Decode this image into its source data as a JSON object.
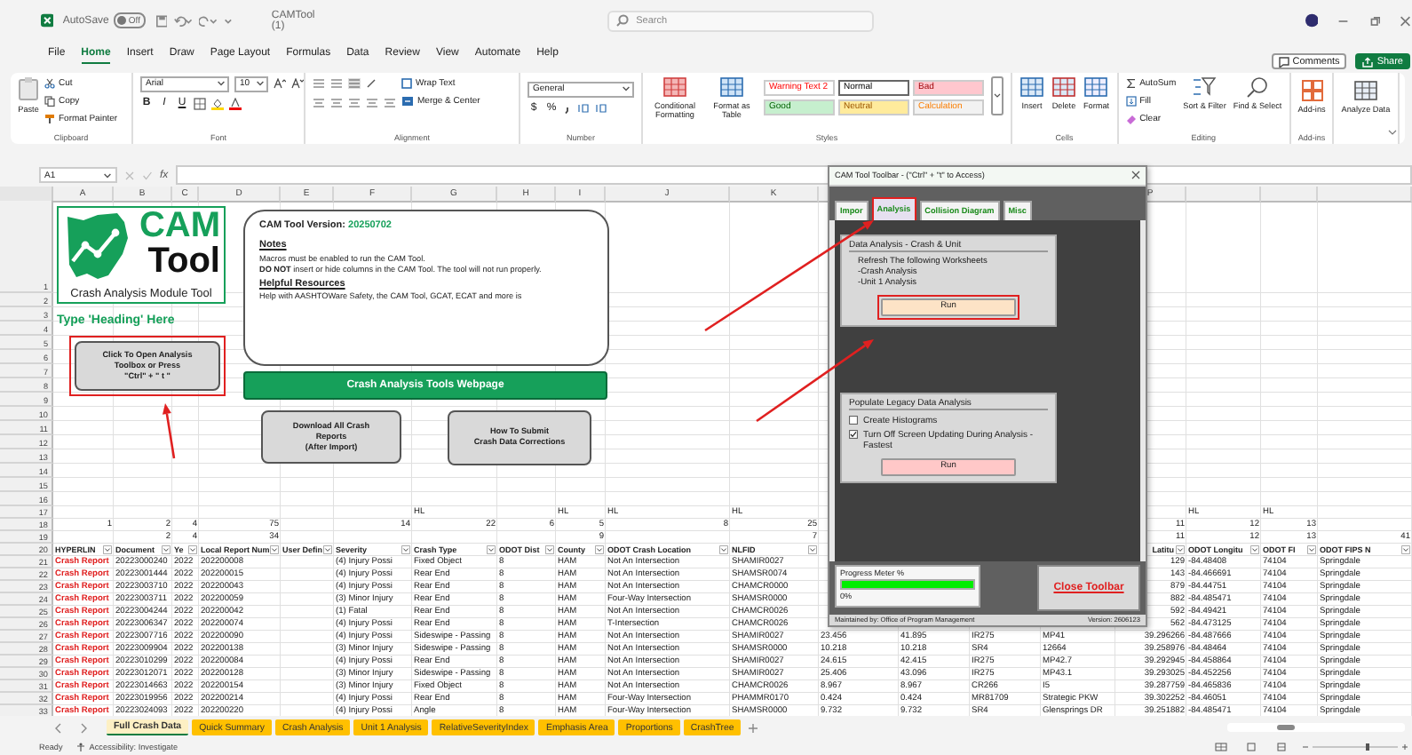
{
  "title_bar": {
    "autosave_label": "AutoSave",
    "autosave_toggle": {
      "label": "Off",
      "on": false
    },
    "file_name": "CAMTool (1)",
    "search_placeholder": "Search"
  },
  "menu": [
    {
      "label": "File",
      "selected": false
    },
    {
      "label": "Home",
      "selected": true
    },
    {
      "label": "Insert",
      "selected": false
    },
    {
      "label": "Draw",
      "selected": false
    },
    {
      "label": "Page Layout",
      "selected": false
    },
    {
      "label": "Formulas",
      "selected": false
    },
    {
      "label": "Data",
      "selected": false
    },
    {
      "label": "Review",
      "selected": false
    },
    {
      "label": "View",
      "selected": false
    },
    {
      "label": "Automate",
      "selected": false
    },
    {
      "label": "Help",
      "selected": false
    }
  ],
  "comments_button": "Comments",
  "share_button": "Share",
  "ribbon": {
    "clipboard": {
      "label": "Clipboard",
      "paste": "Paste",
      "cut": "Cut",
      "copy": "Copy",
      "format_painter": "Format Painter"
    },
    "font": {
      "label": "Font",
      "font_name": "Arial",
      "font_size": "10",
      "bold": "B",
      "italic": "I",
      "underline": "U"
    },
    "alignment": {
      "label": "Alignment",
      "wrap_text": "Wrap Text",
      "merge_center": "Merge & Center"
    },
    "number": {
      "label": "Number",
      "format": "General",
      "currency": "$",
      "percent": "%"
    },
    "styles": {
      "label": "Styles",
      "conditional_formatting": "Conditional Formatting",
      "format_as_table": "Format as Table",
      "cell_styles": [
        {
          "label": "Warning Text 2",
          "kind": "warning",
          "selected": false
        },
        {
          "label": "Normal",
          "kind": "normal",
          "selected": true
        },
        {
          "label": "Bad",
          "kind": "bad",
          "selected": false
        },
        {
          "label": "Good",
          "kind": "good",
          "selected": false
        },
        {
          "label": "Neutral",
          "kind": "neutral",
          "selected": false
        },
        {
          "label": "Calculation",
          "kind": "calculation",
          "selected": false
        }
      ]
    },
    "cells": {
      "label": "Cells",
      "insert": "Insert",
      "delete": "Delete",
      "format": "Format"
    },
    "editing": {
      "label": "Editing",
      "autosum": "AutoSum",
      "fill": "Fill",
      "clear": "Clear",
      "sort_filter": "Sort & Filter",
      "find_select": "Find & Select"
    },
    "add_ins": {
      "label": "Add-ins",
      "button": "Add-ins"
    },
    "analyze": {
      "button": "Analyze Data"
    }
  },
  "formula_bar": {
    "name_box": "A1",
    "fx": "fx"
  },
  "sheet": {
    "column_letters": [
      "A",
      "B",
      "C",
      "D",
      "E",
      "F",
      "G",
      "H",
      "I",
      "J",
      "K"
    ],
    "column_letters_right": [
      "P"
    ],
    "rows": [
      {
        "number": "1"
      },
      {
        "number": "2"
      },
      {
        "number": "3"
      },
      {
        "number": "4"
      },
      {
        "number": "5"
      },
      {
        "number": "6"
      },
      {
        "number": "7"
      },
      {
        "number": "8"
      },
      {
        "number": "9"
      },
      {
        "number": "10"
      },
      {
        "number": "11"
      },
      {
        "number": "12"
      },
      {
        "number": "13"
      },
      {
        "number": "14"
      },
      {
        "number": "15"
      },
      {
        "number": "16"
      },
      {
        "number": "17",
        "kind": "marker",
        "cells": [
          null,
          null,
          null,
          null,
          null,
          null,
          "HL",
          null,
          "HL",
          "HL",
          "HL",
          null,
          null,
          null,
          null,
          null,
          "HL",
          "HL"
        ]
      },
      {
        "number": "18",
        "kind": "index",
        "cells": [
          "1",
          "2",
          "4",
          "75",
          null,
          "14",
          "22",
          "6",
          "5",
          "8",
          "25",
          null,
          null,
          null,
          null,
          "11",
          "12",
          "13"
        ]
      },
      {
        "number": "19",
        "kind": "index",
        "cells": [
          null,
          "2",
          "4",
          "34",
          null,
          null,
          null,
          null,
          "9",
          null,
          "7",
          null,
          null,
          null,
          null,
          "11",
          "12",
          "13",
          "41"
        ]
      },
      {
        "number": "20",
        "kind": "header",
        "cells": [
          "HYPERLIN",
          "Document",
          "Ye",
          "Local Report Num",
          "User Defin",
          "Severity",
          "Crash Type",
          "ODOT Dist",
          "County",
          "ODOT Crash Location",
          "NLFID",
          null,
          null,
          null,
          null,
          "Latitu",
          "ODOT Longitu",
          "ODOT FI",
          "ODOT FIPS N"
        ]
      },
      {
        "number": "21",
        "kind": "data",
        "cells": [
          "Crash Report",
          "20223000240",
          "2022",
          "202200008",
          null,
          "(4) Injury Possi",
          "Fixed Object",
          "8",
          "HAM",
          "Not An Intersection",
          "SHAMIR0027",
          null,
          null,
          null,
          null,
          "129",
          "-84.48408",
          "74104",
          "Springdale"
        ]
      },
      {
        "number": "22",
        "kind": "data",
        "cells": [
          "Crash Report",
          "20223001444",
          "2022",
          "202200015",
          null,
          "(4) Injury Possi",
          "Rear End",
          "8",
          "HAM",
          "Not An Intersection",
          "SHAMSR0074",
          null,
          null,
          null,
          null,
          "143",
          "-84.466691",
          "74104",
          "Springdale"
        ]
      },
      {
        "number": "23",
        "kind": "data",
        "cells": [
          "Crash Report",
          "20223003710",
          "2022",
          "202200043",
          null,
          "(4) Injury Possi",
          "Rear End",
          "8",
          "HAM",
          "Not An Intersection",
          "CHAMCR0000",
          null,
          null,
          null,
          null,
          "879",
          "-84.44751",
          "74104",
          "Springdale"
        ]
      },
      {
        "number": "24",
        "kind": "data",
        "cells": [
          "Crash Report",
          "20223003711",
          "2022",
          "202200059",
          null,
          "(3) Minor Injury",
          "Rear End",
          "8",
          "HAM",
          "Four-Way Intersection",
          "SHAMSR0000",
          null,
          null,
          null,
          null,
          "882",
          "-84.485471",
          "74104",
          "Springdale"
        ]
      },
      {
        "number": "25",
        "kind": "data",
        "cells": [
          "Crash Report",
          "20223004244",
          "2022",
          "202200042",
          null,
          "(1) Fatal",
          "Rear End",
          "8",
          "HAM",
          "Not An Intersection",
          "CHAMCR0026",
          null,
          null,
          null,
          null,
          "592",
          "-84.49421",
          "74104",
          "Springdale"
        ]
      },
      {
        "number": "26",
        "kind": "data",
        "cells": [
          "Crash Report",
          "20223006347",
          "2022",
          "202200074",
          null,
          "(4) Injury Possi",
          "Rear End",
          "8",
          "HAM",
          "T-Intersection",
          "CHAMCR0026",
          null,
          null,
          null,
          null,
          "562",
          "-84.473125",
          "74104",
          "Springdale"
        ]
      },
      {
        "number": "27",
        "kind": "data",
        "cells": [
          "Crash Report",
          "20223007716",
          "2022",
          "202200090",
          null,
          "(4) Injury Possi",
          "Sideswipe - Passing",
          "8",
          "HAM",
          "Not An Intersection",
          "SHAMIR0027",
          "23.456",
          "41.895",
          "IR275",
          "MP41",
          "39.296266",
          "-84.487666",
          "74104",
          "Springdale"
        ]
      },
      {
        "number": "28",
        "kind": "data",
        "cells": [
          "Crash Report",
          "20223009904",
          "2022",
          "202200138",
          null,
          "(3) Minor Injury",
          "Sideswipe - Passing",
          "8",
          "HAM",
          "Not An Intersection",
          "SHAMSR0000",
          "10.218",
          "10.218",
          "SR4",
          "12664",
          "39.258976",
          "-84.48464",
          "74104",
          "Springdale"
        ]
      },
      {
        "number": "29",
        "kind": "data",
        "cells": [
          "Crash Report",
          "20223010299",
          "2022",
          "202200084",
          null,
          "(4) Injury Possi",
          "Rear End",
          "8",
          "HAM",
          "Not An Intersection",
          "SHAMIR0027",
          "24.615",
          "42.415",
          "IR275",
          "MP42.7",
          "39.292945",
          "-84.458864",
          "74104",
          "Springdale"
        ]
      },
      {
        "number": "30",
        "kind": "data",
        "cells": [
          "Crash Report",
          "20223012071",
          "2022",
          "202200128",
          null,
          "(3) Minor Injury",
          "Sideswipe - Passing",
          "8",
          "HAM",
          "Not An Intersection",
          "SHAMIR0027",
          "25.406",
          "43.096",
          "IR275",
          "MP43.1",
          "39.293025",
          "-84.452256",
          "74104",
          "Springdale"
        ]
      },
      {
        "number": "31",
        "kind": "data",
        "cells": [
          "Crash Report",
          "20223014663",
          "2022",
          "202200154",
          null,
          "(3) Minor Injury",
          "Fixed Object",
          "8",
          "HAM",
          "Not An Intersection",
          "CHAMCR0026",
          "8.967",
          "8.967",
          "CR266",
          "I5",
          "39.287759",
          "-84.465836",
          "74104",
          "Springdale"
        ]
      },
      {
        "number": "32",
        "kind": "data",
        "cells": [
          "Crash Report",
          "20223019956",
          "2022",
          "202200214",
          null,
          "(4) Injury Possi",
          "Rear End",
          "8",
          "HAM",
          "Four-Way Intersection",
          "PHAMMR0170",
          "0.424",
          "0.424",
          "MR81709",
          "Strategic PKW",
          "39.302252",
          "-84.46051",
          "74104",
          "Springdale"
        ]
      },
      {
        "number": "33",
        "kind": "data",
        "cells": [
          "Crash Report",
          "20223024093",
          "2022",
          "202200220",
          null,
          "(4) Injury Possi",
          "Angle",
          "8",
          "HAM",
          "Four-Way Intersection",
          "SHAMSR0000",
          "9.732",
          "9.732",
          "SR4",
          "Glensprings DR",
          "39.251882",
          "-84.485471",
          "74104",
          "Springdale"
        ]
      }
    ]
  },
  "logo": {
    "word_1": "CAM",
    "word_2": "Tool",
    "caption": "Crash Analysis Module Tool"
  },
  "heading": "Type 'Heading' Here",
  "open_toolbox_button": "Click To Open Analysis\nToolbox or Press\n\"Ctrl\" + \" t \"",
  "notes_box": {
    "version_label": "CAM Tool Version:",
    "version": "20250702",
    "notes_title": "Notes",
    "notes": [
      "Macros must be enabled to run the CAM Tool.",
      "**DO NOT** insert or hide columns in the CAM Tool. The tool will not run properly."
    ],
    "resources_title": "Helpful Resources",
    "resources": "Help with AASHTOWare Safety, the CAM Tool, GCAT, ECAT and more is"
  },
  "webpage_button": "Crash Analysis Tools Webpage",
  "download_button": "Download All Crash\nReports\n(After Import)",
  "corrections_button": "How To Submit\nCrash Data Corrections",
  "dialog": {
    "title": "CAM Tool Toolbar - (\"Ctrl\" + \"t\" to Access)",
    "tabs": [
      {
        "label": "Impor",
        "selected": false
      },
      {
        "label": "Analysis",
        "selected": true
      },
      {
        "label": "Collision Diagram",
        "selected": false
      },
      {
        "label": "Misc",
        "selected": false
      }
    ],
    "crash_unit": {
      "title": "Data Analysis - Crash & Unit",
      "lines": [
        "Refresh The following Worksheets",
        "-Crash Analysis",
        "-Unit 1 Analysis"
      ],
      "run": "Run"
    },
    "legacy": {
      "title": "Populate Legacy Data Analysis",
      "options": [
        {
          "label": "Create Histograms",
          "checked": false
        },
        {
          "label": "Turn Off Screen Updating During Analysis - Fastest",
          "checked": true
        }
      ],
      "run": "Run"
    },
    "progress": {
      "label": "Progress Meter %",
      "level": 1,
      "reading": "0%"
    },
    "close_button": "Close Toolbar",
    "maintainer": "Maintained by: Office of Program Management",
    "version": "Version: 2606123"
  },
  "sheet_tabs": [
    {
      "label": "Full Crash Data",
      "selected": true
    },
    {
      "label": "Quick Summary",
      "selected": false
    },
    {
      "label": "Crash Analysis",
      "selected": false
    },
    {
      "label": "Unit 1 Analysis",
      "selected": false
    },
    {
      "label": "RelativeSeverityIndex",
      "selected": false
    },
    {
      "label": "Emphasis Area",
      "selected": false
    },
    {
      "label": "Proportions",
      "selected": false
    },
    {
      "label": "CrashTree",
      "selected": false
    }
  ],
  "status_bar": {
    "ready": "Ready",
    "accessibility": "Accessibility: Investigate"
  }
}
